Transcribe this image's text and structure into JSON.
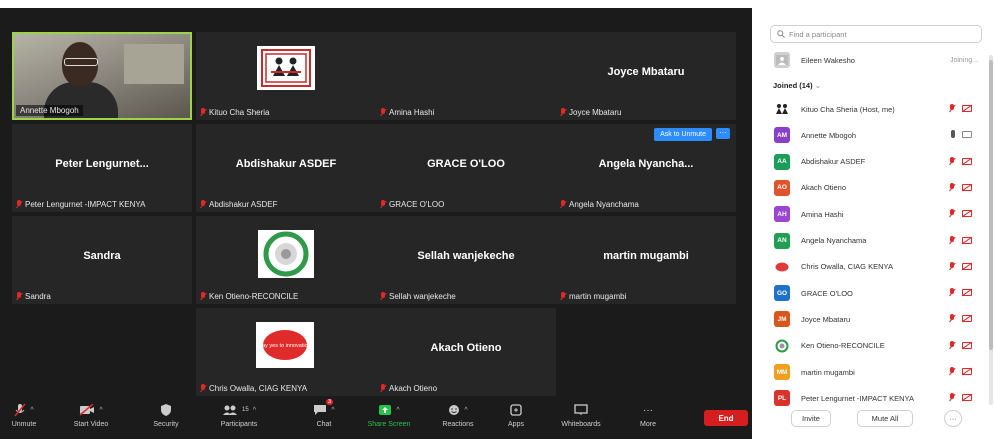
{
  "tiles": [
    {
      "label": "Annette Mbogoh"
    },
    {
      "label": "Kituo Cha Sheria"
    },
    {
      "label": "Amina Hashi"
    },
    {
      "name": "Joyce Mbataru",
      "label": "Joyce Mbataru"
    },
    {
      "name": "Peter Lengurnet...",
      "label": "Peter Lengurnet -IMPACT KENYA"
    },
    {
      "name": "Abdishakur ASDEF",
      "label": "Abdishakur ASDEF"
    },
    {
      "name": "GRACE O'LOO",
      "label": "GRACE O'LOO"
    },
    {
      "name": "Angela Nyancha...",
      "label": "Angela Nyanchama"
    },
    {
      "name": "Sandra",
      "label": "Sandra"
    },
    {
      "label": "Ken Otieno-RECONCILE"
    },
    {
      "name": "Sellah wanjekeche",
      "label": "Sellah wanjekeche"
    },
    {
      "name": "martin mugambi",
      "label": "martin mugambi"
    },
    {
      "label": "Chris Owalla, CIAG KENYA"
    },
    {
      "name": "Akach Otieno",
      "label": "Akach Otieno"
    }
  ],
  "tile_actions": {
    "ask_unmute": "Ask to Unmute",
    "more": "···"
  },
  "chris_logo_text": "say yes to innovation",
  "toolbar": {
    "unmute": "Unmute",
    "start_video": "Start Video",
    "security": "Security",
    "participants": "Participants",
    "participants_count": "15",
    "chat": "Chat",
    "chat_badge": "3",
    "share_screen": "Share Screen",
    "reactions": "Reactions",
    "apps": "Apps",
    "whiteboards": "Whiteboards",
    "more": "More",
    "end": "End"
  },
  "panel": {
    "search_placeholder": "Find a participant",
    "joining_name": "Eileen Wakesho",
    "joining_status": "Joining...",
    "joined_header": "Joined (14)",
    "participants": [
      {
        "initials": "",
        "name": "Kituo Cha Sheria (Host, me)",
        "color": "#ffffff"
      },
      {
        "initials": "AM",
        "name": "Annette Mbogoh",
        "color": "#8a3fc9"
      },
      {
        "initials": "AA",
        "name": "Abdishakur ASDEF",
        "color": "#1a9e5a"
      },
      {
        "initials": "AO",
        "name": "Akach Otieno",
        "color": "#e0542b"
      },
      {
        "initials": "AH",
        "name": "Amina Hashi",
        "color": "#9b45d1"
      },
      {
        "initials": "AN",
        "name": "Angela Nyanchama",
        "color": "#1f9e54"
      },
      {
        "initials": "",
        "name": "Chris Owalla, CIAG KENYA",
        "color": "#e03a3a"
      },
      {
        "initials": "GO",
        "name": "GRACE O'LOO",
        "color": "#1e73c8"
      },
      {
        "initials": "JM",
        "name": "Joyce Mbataru",
        "color": "#d9571c"
      },
      {
        "initials": "",
        "name": "Ken Otieno-RECONCILE",
        "color": "#ffffff"
      },
      {
        "initials": "MM",
        "name": "martin mugambi",
        "color": "#f0a020"
      },
      {
        "initials": "PL",
        "name": "Peter Lengurnet -IMPACT KENYA",
        "color": "#d9342b"
      }
    ],
    "invite": "Invite",
    "mute_all": "Mute All",
    "more": "···"
  }
}
